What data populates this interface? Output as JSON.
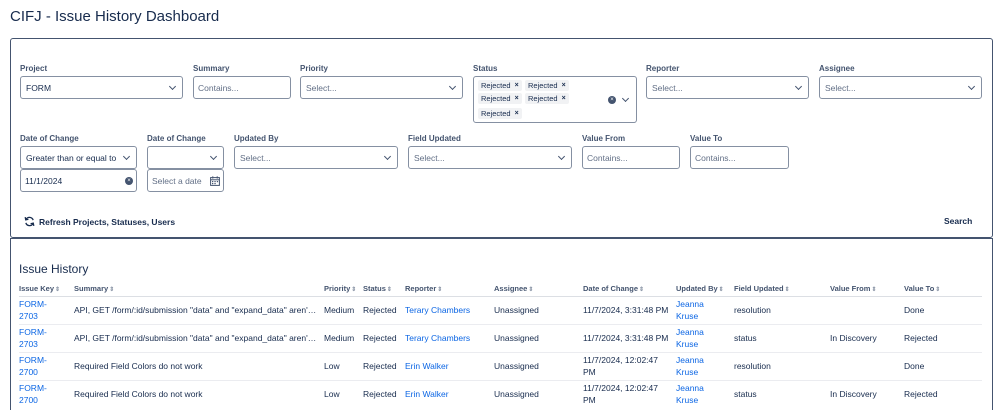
{
  "page": {
    "title": "CIFJ - Issue History Dashboard"
  },
  "filters": {
    "project": {
      "label": "Project",
      "value": "FORM"
    },
    "summary": {
      "label": "Summary",
      "placeholder": "Contains..."
    },
    "priority": {
      "label": "Priority",
      "placeholder": "Select..."
    },
    "status": {
      "label": "Status",
      "chips": [
        "Rejected",
        "Rejected",
        "Rejected",
        "Rejected",
        "Rejected"
      ]
    },
    "reporter": {
      "label": "Reporter",
      "placeholder": "Select..."
    },
    "assignee": {
      "label": "Assignee",
      "placeholder": "Select..."
    },
    "date_op": {
      "label": "Date of Change",
      "value": "Greater than or equal to"
    },
    "date_value": {
      "value": "11/1/2024"
    },
    "date_op2": {
      "label": "Date of Change",
      "value": ""
    },
    "date_value2": {
      "placeholder": "Select a date"
    },
    "updated_by": {
      "label": "Updated By",
      "placeholder": "Select..."
    },
    "field_updated": {
      "label": "Field Updated",
      "placeholder": "Select..."
    },
    "value_from": {
      "label": "Value From",
      "placeholder": "Contains..."
    },
    "value_to": {
      "label": "Value To",
      "placeholder": "Contains..."
    },
    "refresh_label": "Refresh Projects, Statuses, Users",
    "search_label": "Search"
  },
  "history": {
    "title": "Issue History",
    "columns": [
      "Issue Key",
      "Summary",
      "Priority",
      "Status",
      "Reporter",
      "Assignee",
      "Date of Change",
      "Updated By",
      "Field Updated",
      "Value From",
      "Value To"
    ],
    "rows": [
      {
        "key1": "FORM-",
        "key2": "2703",
        "summary": "API, GET /form/:id/submission \"data\" and \"expand_data\" aren'…",
        "priority": "Medium",
        "status": "Rejected",
        "reporter": "Terary Chambers",
        "assignee": "Unassigned",
        "date": "11/7/2024, 3:31:48 PM",
        "updated1": "Jeanna",
        "updated2": "Kruse",
        "field": "resolution",
        "from": "",
        "to": "Done"
      },
      {
        "key1": "FORM-",
        "key2": "2703",
        "summary": "API, GET /form/:id/submission \"data\" and \"expand_data\" aren'…",
        "priority": "Medium",
        "status": "Rejected",
        "reporter": "Terary Chambers",
        "assignee": "Unassigned",
        "date": "11/7/2024, 3:31:48 PM",
        "updated1": "Jeanna",
        "updated2": "Kruse",
        "field": "status",
        "from": "In Discovery",
        "to": "Rejected"
      },
      {
        "key1": "FORM-",
        "key2": "2700",
        "summary": "Required Field Colors do not work",
        "priority": "Low",
        "status": "Rejected",
        "reporter": "Erin Walker",
        "assignee": "Unassigned",
        "date": "11/7/2024, 12:02:47 PM",
        "updated1": "Jeanna",
        "updated2": "Kruse",
        "field": "resolution",
        "from": "",
        "to": "Done"
      },
      {
        "key1": "FORM-",
        "key2": "2700",
        "summary": "Required Field Colors do not work",
        "priority": "Low",
        "status": "Rejected",
        "reporter": "Erin Walker",
        "assignee": "Unassigned",
        "date": "11/7/2024, 12:02:47 PM",
        "updated1": "Jeanna",
        "updated2": "Kruse",
        "field": "status",
        "from": "In Discovery",
        "to": "Rejected"
      }
    ]
  }
}
